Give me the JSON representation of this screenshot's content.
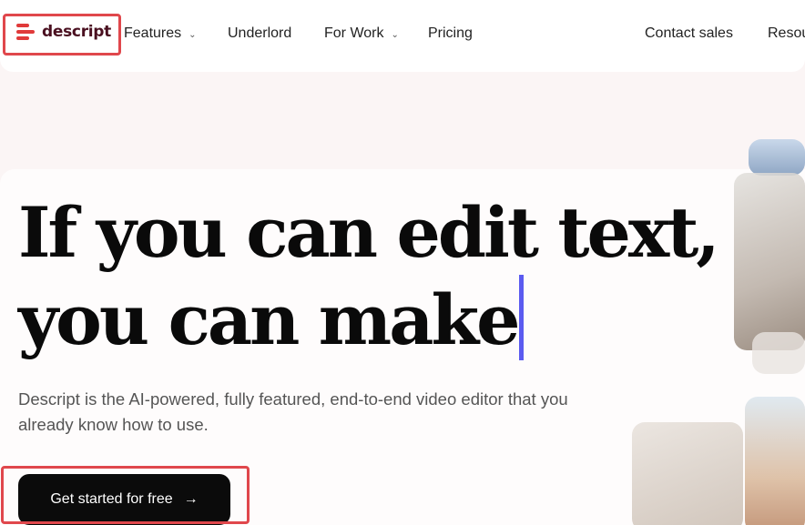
{
  "nav": {
    "logo_text": "descript",
    "items": [
      {
        "label": "Features",
        "chevron": "⌄"
      },
      {
        "label": "Underlord"
      },
      {
        "label": "For Work",
        "chevron": "⌄"
      },
      {
        "label": "Pricing"
      }
    ],
    "right_items": [
      {
        "label": "Contact sales"
      },
      {
        "label": "Resou"
      }
    ]
  },
  "hero": {
    "line1": "If you can edit text,",
    "line2": "you can make",
    "subtext": "Descript is the AI-powered, fully featured, end-to-end video editor that you already know how to use.",
    "cta_label": "Get started for free",
    "cta_arrow": "→"
  },
  "colors": {
    "accent": "#e03a3a",
    "cursor": "#5b5bf0",
    "annotation": "#e0474c"
  }
}
